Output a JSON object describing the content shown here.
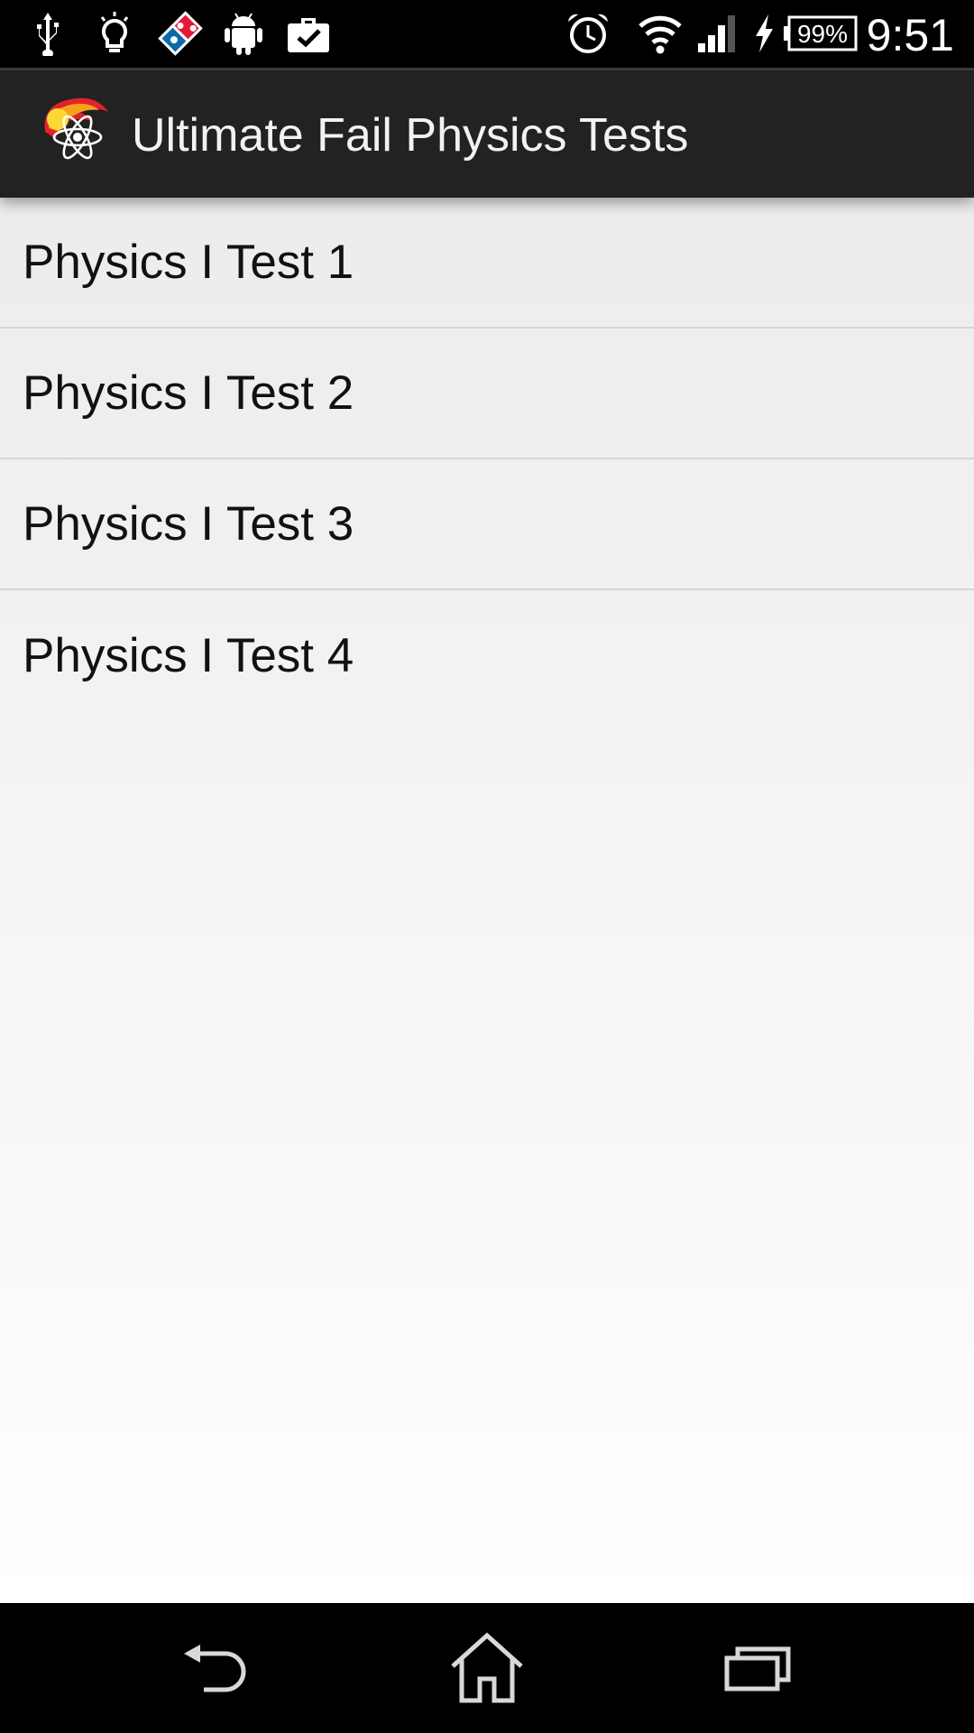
{
  "status_bar": {
    "time": "9:51",
    "battery": "99%",
    "icons": [
      "usb-icon",
      "lightbulb-icon",
      "dominos-icon",
      "android-icon",
      "briefcase-check-icon",
      "alarm-icon",
      "wifi-icon",
      "signal-icon",
      "charging-icon",
      "battery-icon"
    ]
  },
  "action_bar": {
    "title": "Ultimate Fail Physics Tests",
    "icon": "atom-fireball-logo"
  },
  "list": {
    "items": [
      {
        "label": "Physics I Test 1"
      },
      {
        "label": "Physics I Test 2"
      },
      {
        "label": "Physics I Test 3"
      },
      {
        "label": "Physics I Test 4"
      }
    ]
  },
  "nav_bar": {
    "buttons": [
      "back-icon",
      "home-icon",
      "recent-apps-icon"
    ]
  },
  "colors": {
    "action_bar_bg": "#222222",
    "list_bg_top": "#ececec",
    "list_bg_bottom": "#ffffff",
    "divider": "#d6d6d6"
  }
}
